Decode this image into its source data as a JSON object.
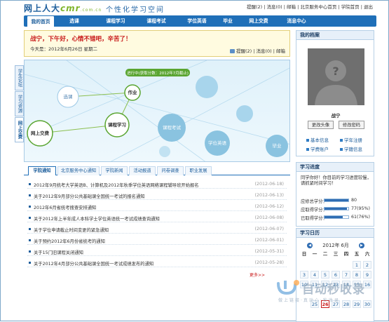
{
  "header": {
    "logo_main": "网上人大",
    "logo_brand": "cmr",
    "logo_domain": ".com.cn",
    "slogan": "个性化学习空间",
    "links": "提醒(2) | 消息(0) | 邮箱 | 北京服务中心首页 | 学院首页 | 退出"
  },
  "nav": [
    "我的首页",
    "选课",
    "课程学习",
    "课程考试",
    "学位英语",
    "毕业",
    "网上交费",
    "消息中心"
  ],
  "greeting": {
    "message": "战宁，下午好，心情不错吧，辛苦了！",
    "today": "今天是：2012年6月26日 星期二",
    "links": "提醒(2) | 消息(0) | 邮箱"
  },
  "sidetabs": [
    "学生论坛",
    "学习资源",
    "网上交费"
  ],
  "map": {
    "tip": "进行中(获取分数：2012年7月截止)",
    "nodes": [
      "选课",
      "作业",
      "课程学习",
      "网上交费",
      "课程考试",
      "学位英语",
      "毕业"
    ]
  },
  "tabs": [
    "学院通知",
    "北京服务中心通知",
    "学院新闻",
    "活动报道",
    "问卷调查",
    "职业发展"
  ],
  "notices": [
    {
      "title": "2012年9月统考大学英语B、计算机及2012年秋季学位英语网络课程辅导班开始报名",
      "date": "(2012-06-18)"
    },
    {
      "title": "关于2012年9月部分公共基础课全国统一考试的报名通知",
      "date": "(2012-06-13)"
    },
    {
      "title": "2012年6月省统考搜查安排通知",
      "date": "(2012-06-12)"
    },
    {
      "title": "关于2012年上半年成人本科学士学位英语统一考试成绩查询通知",
      "date": "(2012-06-08)"
    },
    {
      "title": "关于学位申请截止时间变更的紧急通知",
      "date": "(2012-06-07)"
    },
    {
      "title": "关于预约2012年6月份省统考的通知",
      "date": "(2012-06-01)"
    },
    {
      "title": "关于15门旧课程关闭通知",
      "date": "(2012-05-31)"
    },
    {
      "title": "关于2012年4月部分公共基础课全国统一考试成绩发布的通知",
      "date": "(2012-05-28)"
    }
  ],
  "more": "更多>>",
  "profile": {
    "title": "我的档案",
    "name": "战宁",
    "buttons": [
      "更改头像",
      "修改密码"
    ],
    "links": [
      "基本信息",
      "学年注册",
      "学费账户",
      "学籍信息"
    ]
  },
  "progress": {
    "title": "学习进度",
    "question": "同学你好！你目前的学习进度较慢，请抓紧时间学习！",
    "rows": [
      {
        "label": "应修总学分：",
        "value": "80",
        "fill": 1.0
      },
      {
        "label": "应取得学分：",
        "value": "77(95%)",
        "fill": 0.95
      },
      {
        "label": "已取得学分：",
        "value": "61(76%)",
        "fill": 0.76
      }
    ]
  },
  "calendar": {
    "title": "学习日历",
    "month": "2012年 6月",
    "weekdays": [
      "日",
      "一",
      "二",
      "三",
      "四",
      "五",
      "六"
    ],
    "visible_days": [
      "1",
      "2",
      "3",
      "4",
      "5",
      "6",
      "7",
      "8",
      "9",
      "10",
      "11",
      "12",
      "13",
      "14",
      "15",
      "16",
      "25",
      "26",
      "27",
      "28",
      "29",
      "30"
    ],
    "today": "26"
  },
  "watermark": {
    "text": "自动秒收录",
    "sub": "做上链接·真动心·秒收录"
  },
  "colors": {
    "brand_blue": "#1f6fb8",
    "accent_green": "#7fb52a",
    "alert_red": "#c81818"
  }
}
